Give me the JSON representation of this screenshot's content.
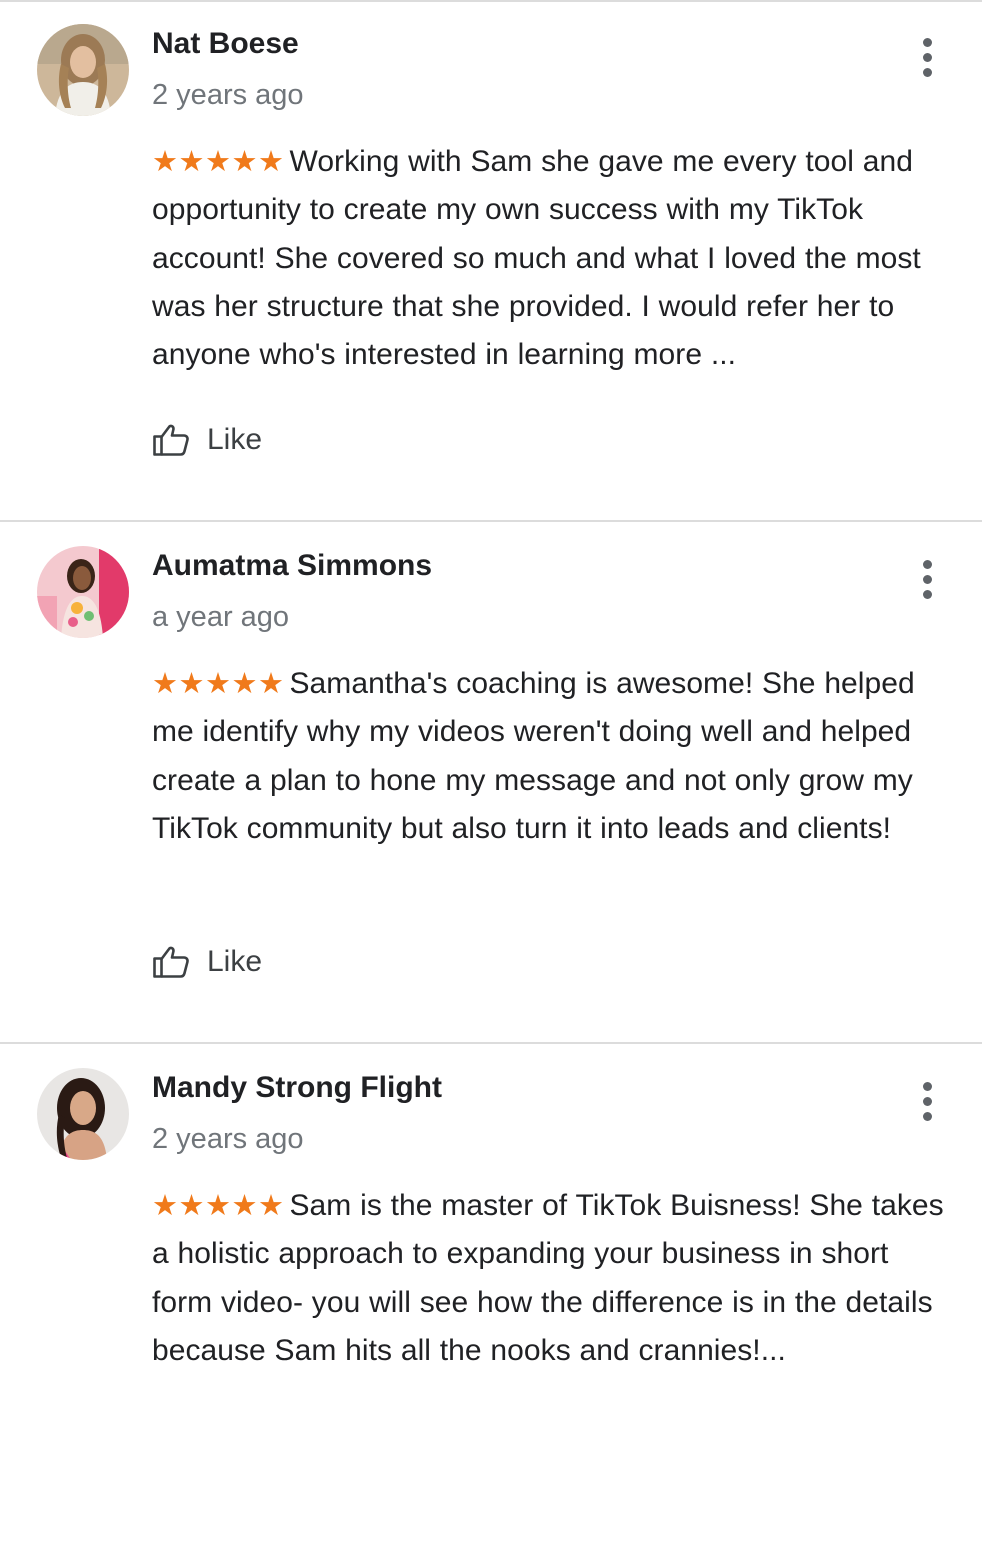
{
  "colors": {
    "star": "#f07a1b",
    "name": "#202124",
    "timestamp": "#70757a",
    "divider": "#dcdcdc",
    "icon": "#5f6368"
  },
  "icons": {
    "more": "more-vert-icon",
    "like": "thumb-up-outline-icon",
    "star": "star-icon"
  },
  "reviews": [
    {
      "author": "Nat Boese",
      "time": "2 years ago",
      "rating": 5,
      "stars": "★★★★★",
      "text": "Working with Sam she gave me every tool and opportunity to create my own success with my TikTok account! She covered so much and what I loved the most was her structure that she provided. I would refer her to anyone who's interested in learning more ...",
      "like_label": "Like"
    },
    {
      "author": "Aumatma Simmons",
      "time": "a year ago",
      "rating": 5,
      "stars": "★★★★★",
      "text": "Samantha's coaching is awesome! She helped me identify why my videos weren't doing well and helped create a plan to hone my message and not only grow my TikTok community but also turn it into leads and clients!",
      "like_label": "Like"
    },
    {
      "author": "Mandy Strong Flight",
      "time": "2 years ago",
      "rating": 5,
      "stars": "★★★★★",
      "text": "Sam is the master of TikTok Buisness! She takes a holistic approach to expanding your business in short form video- you will see how the difference is in the details because Sam hits all the nooks and crannies!...",
      "like_label": null
    }
  ]
}
